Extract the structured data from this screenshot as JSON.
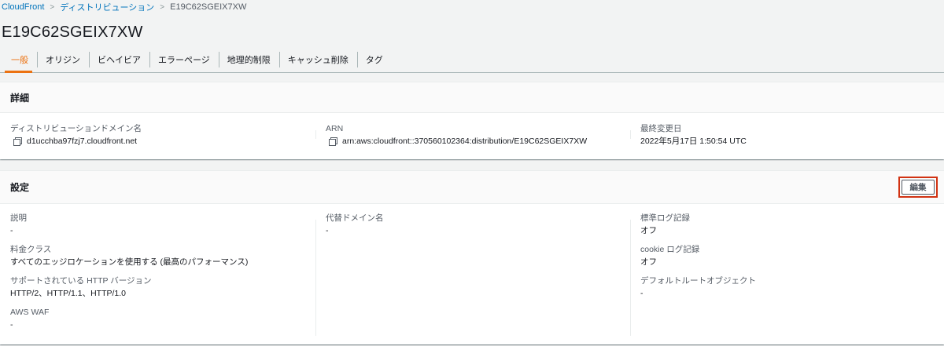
{
  "breadcrumb": {
    "items": [
      "CloudFront",
      "ディストリビューション"
    ],
    "current": "E19C62SGEIX7XW"
  },
  "page": {
    "title": "E19C62SGEIX7XW"
  },
  "tabs": [
    {
      "label": "一般",
      "active": true
    },
    {
      "label": "オリジン"
    },
    {
      "label": "ビヘイビア"
    },
    {
      "label": "エラーページ"
    },
    {
      "label": "地理的制限"
    },
    {
      "label": "キャッシュ削除"
    },
    {
      "label": "タグ"
    }
  ],
  "details": {
    "title": "詳細",
    "domain": {
      "label": "ディストリビューションドメイン名",
      "value": "d1ucchba97fzj7.cloudfront.net"
    },
    "arn": {
      "label": "ARN",
      "value": "arn:aws:cloudfront::370560102364:distribution/E19C62SGEIX7XW"
    },
    "modified": {
      "label": "最終変更日",
      "value": "2022年5月17日 1:50:54 UTC"
    }
  },
  "settings": {
    "title": "設定",
    "edit_label": "編集",
    "description": {
      "label": "説明",
      "value": "-"
    },
    "price_class": {
      "label": "料金クラス",
      "value": "すべてのエッジロケーションを使用する (最高のパフォーマンス)"
    },
    "http_versions": {
      "label": "サポートされている HTTP バージョン",
      "value": "HTTP/2、HTTP/1.1、HTTP/1.0"
    },
    "waf": {
      "label": "AWS WAF",
      "value": "-"
    },
    "alt_domain": {
      "label": "代替ドメイン名",
      "value": "-"
    },
    "std_logging": {
      "label": "標準ログ記録",
      "value": "オフ"
    },
    "cookie_logging": {
      "label": "cookie ログ記録",
      "value": "オフ"
    },
    "default_root": {
      "label": "デフォルトルートオブジェクト",
      "value": "-"
    }
  },
  "colors": {
    "accent": "#ec7211",
    "link": "#0073bb",
    "highlight": "#d13212"
  }
}
